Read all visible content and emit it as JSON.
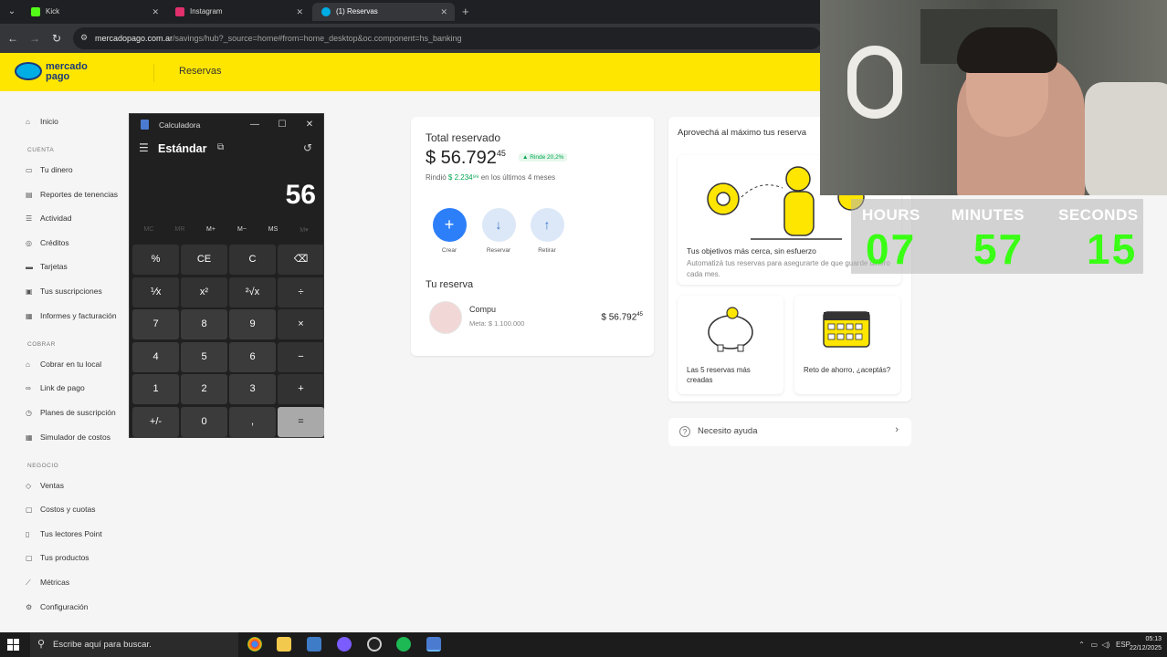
{
  "browser": {
    "tabs": [
      {
        "title": "Kick",
        "color": "#53fc18"
      },
      {
        "title": "Instagram",
        "color": "#e1306c"
      },
      {
        "title": "(1) Reservas",
        "color": "#00aee6"
      }
    ],
    "url_domain": "mercadopago.com.ar",
    "url_path": "/savings/hub?_source=home#from=home_desktop&oc.component=hs_banking"
  },
  "mp": {
    "logo_line1": "mercado",
    "logo_line2": "pago",
    "nav_reservas": "Reservas",
    "brand_yellow": "#ffe600"
  },
  "sidebar": {
    "inicio": "Inicio",
    "cuenta_head": "CUENTA",
    "cuenta_items": [
      "Tu dinero",
      "Reportes de tenencias",
      "Actividad",
      "Créditos",
      "Tarjetas",
      "Tus suscripciones",
      "Informes y facturación"
    ],
    "cobrar_head": "COBRAR",
    "cobrar_items": [
      "Cobrar en tu local",
      "Link de pago",
      "Planes de suscripción",
      "Simulador de costos"
    ],
    "negocio_head": "NEGOCIO",
    "negocio_items": [
      "Ventas",
      "Costos y cuotas",
      "Tus lectores Point",
      "Tus productos",
      "Métricas",
      "Configuración"
    ]
  },
  "calculator": {
    "title": "Calculadora",
    "mode": "Estándar",
    "display": "56",
    "memory": [
      "MC",
      "MR",
      "M+",
      "M−",
      "MS",
      "M▾"
    ],
    "keys": [
      [
        "%",
        "CE",
        "C",
        "⌫"
      ],
      [
        "⅟x",
        "x²",
        "²√x",
        "÷"
      ],
      [
        "7",
        "8",
        "9",
        "×"
      ],
      [
        "4",
        "5",
        "6",
        "−"
      ],
      [
        "1",
        "2",
        "3",
        "+"
      ],
      [
        "+/-",
        "0",
        ",",
        "="
      ]
    ]
  },
  "reserva": {
    "total_label": "Total reservado",
    "amount_int": "$ 56.792",
    "amount_dec": "45",
    "rinde": "▲ Rinde 20,2%",
    "rindio_prefix": "Rindió",
    "rindio_value": "$ 2.234⁹⁹",
    "rindio_suffix": "en los últimos 4 meses",
    "actions": [
      "Crear",
      "Reservar",
      "Retirar"
    ],
    "tu_reserva": "Tu reserva",
    "item_name": "Compu",
    "item_meta": "Meta: $ 1.100.000",
    "item_amount_int": "$ 56.792",
    "item_amount_dec": "45"
  },
  "promo": {
    "title": "Aprovechá al máximo tus reserva",
    "big_title": "Tus objetivos más cerca, sin esfuerzo",
    "big_desc": "Automatizá tus reservas para asegurarte de que guarde dinero cada mes.",
    "card1": "Las 5 reservas más creadas",
    "card2": "Reto de ahorro, ¿aceptás?",
    "help": "Necesito ayuda"
  },
  "timer": {
    "hours_label": "HOURS",
    "minutes_label": "MINUTES",
    "seconds_label": "SECONDS",
    "hours": "07",
    "minutes": "57",
    "seconds": "15",
    "color": "#39ff14"
  },
  "taskbar": {
    "search_placeholder": "Escribe aquí para buscar.",
    "lang": "ESP",
    "time": "05:13",
    "date": "22/12/2025"
  }
}
